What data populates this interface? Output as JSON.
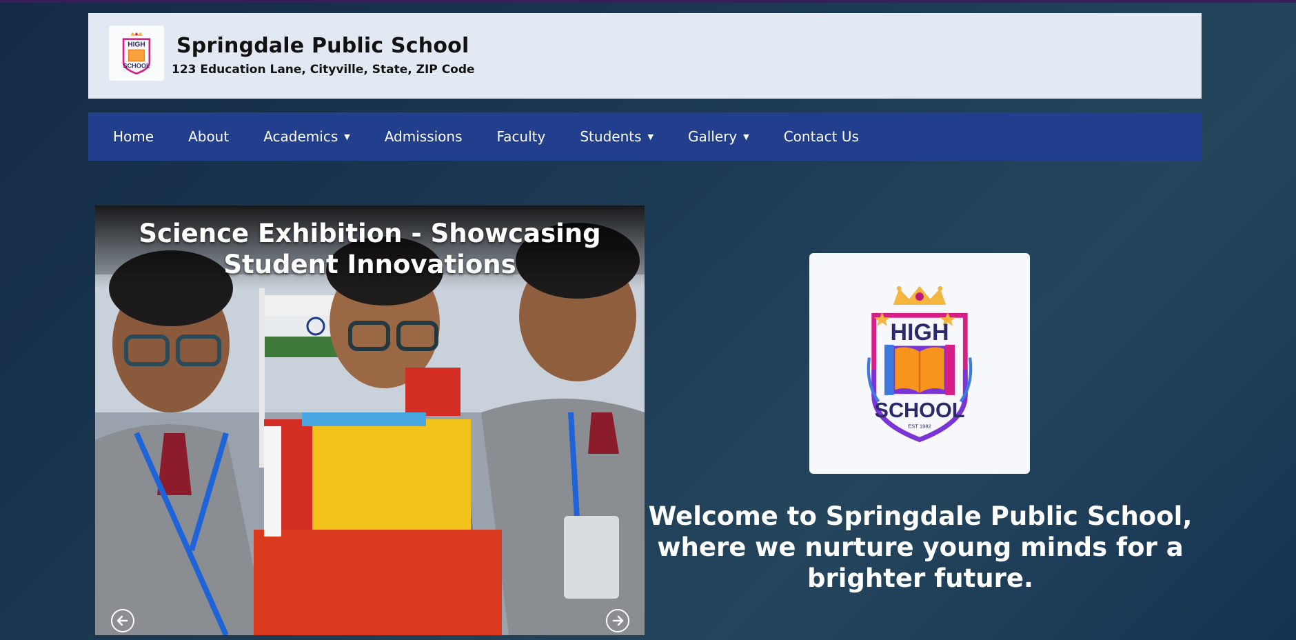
{
  "header": {
    "school_name": "Springdale Public School",
    "address": "123 Education Lane, Cityville, State, ZIP Code"
  },
  "logo": {
    "top_word": "HIGH",
    "bottom_word": "SCHOOL",
    "est": "EST 1982"
  },
  "nav": {
    "items": [
      {
        "label": "Home",
        "dropdown": false
      },
      {
        "label": "About",
        "dropdown": false
      },
      {
        "label": "Academics",
        "dropdown": true
      },
      {
        "label": "Admissions",
        "dropdown": false
      },
      {
        "label": "Faculty",
        "dropdown": false
      },
      {
        "label": "Students",
        "dropdown": true
      },
      {
        "label": "Gallery",
        "dropdown": true
      },
      {
        "label": "Contact Us",
        "dropdown": false
      }
    ],
    "caret": "▼"
  },
  "slider": {
    "caption_line1": "Science Exhibition - Showcasing",
    "caption_line2": "Student Innovations",
    "prev_icon": "arrow-left-circle-icon",
    "next_icon": "arrow-right-circle-icon"
  },
  "welcome": {
    "line1": "Welcome to Springdale Public School,",
    "line2": "where we nurture young minds for a",
    "line3": "brighter future."
  },
  "colors": {
    "nav_bg": "#213f8c",
    "header_bg": "#e3e9f2",
    "page_bg": "#1d3a55"
  }
}
